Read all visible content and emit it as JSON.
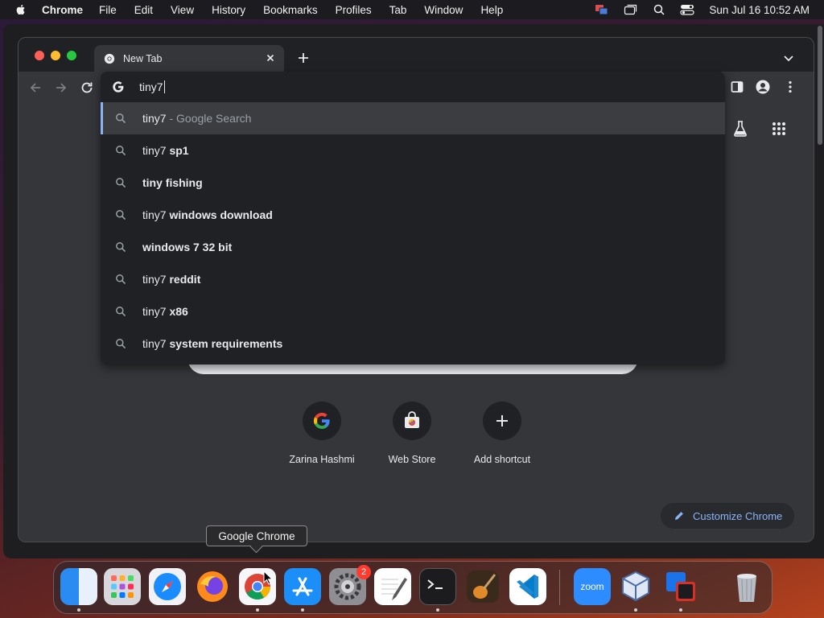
{
  "menubar": {
    "app_name": "Chrome",
    "items": [
      "File",
      "Edit",
      "View",
      "History",
      "Bookmarks",
      "Profiles",
      "Tab",
      "Window",
      "Help"
    ],
    "clock": "Sun Jul 16  10:52 AM"
  },
  "browser": {
    "tab_title": "New Tab",
    "omnibox_value": "tiny7",
    "suggestions": [
      {
        "typed": "tiny7",
        "completion": "",
        "desc": " - Google Search"
      },
      {
        "typed": "tiny7",
        "completion": " sp1",
        "desc": ""
      },
      {
        "typed": "",
        "completion": "tiny fishing",
        "desc": ""
      },
      {
        "typed": "tiny7",
        "completion": " windows download",
        "desc": ""
      },
      {
        "typed": "",
        "completion": "windows 7 32 bit",
        "desc": ""
      },
      {
        "typed": "tiny7",
        "completion": " reddit",
        "desc": ""
      },
      {
        "typed": "tiny7",
        "completion": " x86",
        "desc": ""
      },
      {
        "typed": "tiny7",
        "completion": " system requirements",
        "desc": ""
      }
    ]
  },
  "ntp": {
    "shortcuts": [
      "Zarina Hashmi",
      "Web Store",
      "Add shortcut"
    ],
    "customize_label": "Customize Chrome"
  },
  "dock": {
    "tooltip": "Google Chrome",
    "settings_badge": "2",
    "zoom_label": "zoom"
  },
  "colors": {
    "accent": "#8ab4f8",
    "chrome_bg": "#35363a",
    "popup_bg": "#202124"
  }
}
